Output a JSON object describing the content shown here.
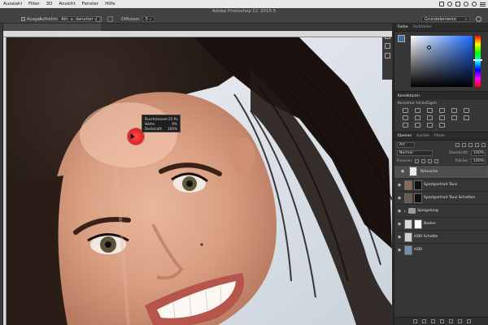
{
  "menubar": {
    "items": [
      "Auswahl",
      "Filter",
      "3D",
      "Ansicht",
      "Fenster",
      "Hilfe"
    ]
  },
  "app": {
    "title": "Adobe Photoshop CC 2015.5"
  },
  "options": {
    "sample_label": "Ausgei",
    "align_label": "Aufnehm",
    "sample_value": "Akt. u. darunter",
    "diffusion_label": "Diffusion:",
    "diffusion_value": "5",
    "workspace": "Grundelemente"
  },
  "tooltip": {
    "diameter_label": "Durchmesser:",
    "diameter_value": "25 Px",
    "hardness_label": "Härte:",
    "hardness_value": "0%",
    "opacity_label": "Deckkraft:",
    "opacity_value": "100%"
  },
  "color_panel": {
    "tabs": [
      "Farbe",
      "Farbfelder"
    ],
    "foreground": "#3b6ea5",
    "background": "#ffffff"
  },
  "corrections": {
    "title": "Korrekturen",
    "subtitle": "Korrektur hinzufügen"
  },
  "layers_panel": {
    "tabs": [
      "Ebenen",
      "Kanäle",
      "Pfade"
    ],
    "filter_value": "Art",
    "blend_mode": "Normal",
    "opacity_label": "Deckkraft:",
    "opacity_value": "100%",
    "fixieren_label": "Fixieren:",
    "fill_label": "Fläche:",
    "fill_value": "100%",
    "layers": [
      {
        "name": "Retusche",
        "type": "pixel",
        "selected": true
      },
      {
        "name": "Sportportrait Tanz",
        "type": "masked",
        "selected": false
      },
      {
        "name": "Sportportrait Tanz Schatten",
        "type": "masked",
        "selected": false
      },
      {
        "name": "Spiegelung",
        "type": "group",
        "selected": false
      },
      {
        "name": "Boden",
        "type": "masked",
        "selected": false
      },
      {
        "name": "HDR Schatte",
        "type": "masked",
        "selected": false
      },
      {
        "name": "HDR",
        "type": "pixel",
        "selected": false
      }
    ]
  }
}
